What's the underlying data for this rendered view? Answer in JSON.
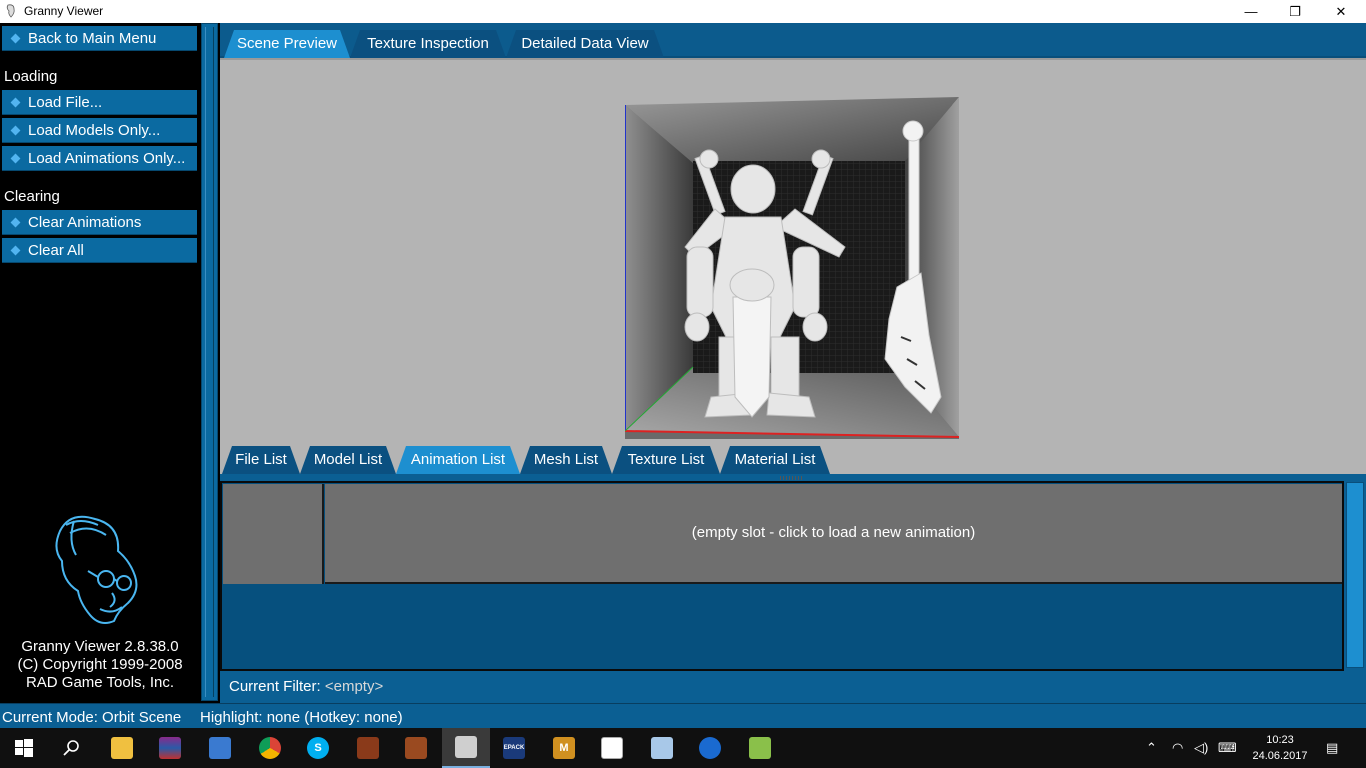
{
  "window": {
    "title": "Granny Viewer",
    "minimize": "—",
    "restore": "❐",
    "close": "✕"
  },
  "sidebar": {
    "back_button": "Back to Main Menu",
    "loading_label": "Loading",
    "loading_items": [
      "Load File...",
      "Load Models Only...",
      "Load Animations Only..."
    ],
    "clearing_label": "Clearing",
    "clearing_items": [
      "Clear Animations",
      "Clear All"
    ],
    "about": {
      "version": "Granny Viewer 2.8.38.0",
      "copyright": "(C) Copyright 1999-2008",
      "company": "RAD Game Tools, Inc."
    }
  },
  "top_tabs": [
    {
      "label": "Scene Preview",
      "active": true
    },
    {
      "label": "Texture Inspection",
      "active": false
    },
    {
      "label": "Detailed Data View",
      "active": false
    }
  ],
  "bottom_tabs": [
    {
      "label": "File List",
      "active": false
    },
    {
      "label": "Model List",
      "active": false
    },
    {
      "label": "Animation List",
      "active": true
    },
    {
      "label": "Mesh List",
      "active": false
    },
    {
      "label": "Texture List",
      "active": false
    },
    {
      "label": "Material List",
      "active": false
    }
  ],
  "animation_list": {
    "empty_slot": "(empty slot - click to load a new animation)"
  },
  "filter": {
    "label": "Current Filter:",
    "value": "<empty>"
  },
  "status": {
    "mode": "Current Mode: Orbit Scene",
    "highlight": "Highlight: none (Hotkey: none)"
  },
  "taskbar": {
    "items": [
      "start-icon",
      "search-icon",
      "file-explorer-icon",
      "winrar-icon",
      "network-app-icon",
      "chrome-icon",
      "skype-icon",
      "game-icon",
      "game-icon-2",
      "granny-viewer-icon",
      "epack-icon",
      "metin2-icon",
      "photos-icon",
      "monitor-app-icon",
      "teamviewer-icon",
      "notepad-icon"
    ],
    "epack_label": "EPACK",
    "clock_time": "10:23",
    "clock_date": "24.06.2017",
    "colors": {
      "accent": "#0b6aa1",
      "active_tab": "#1d8fd0"
    }
  }
}
